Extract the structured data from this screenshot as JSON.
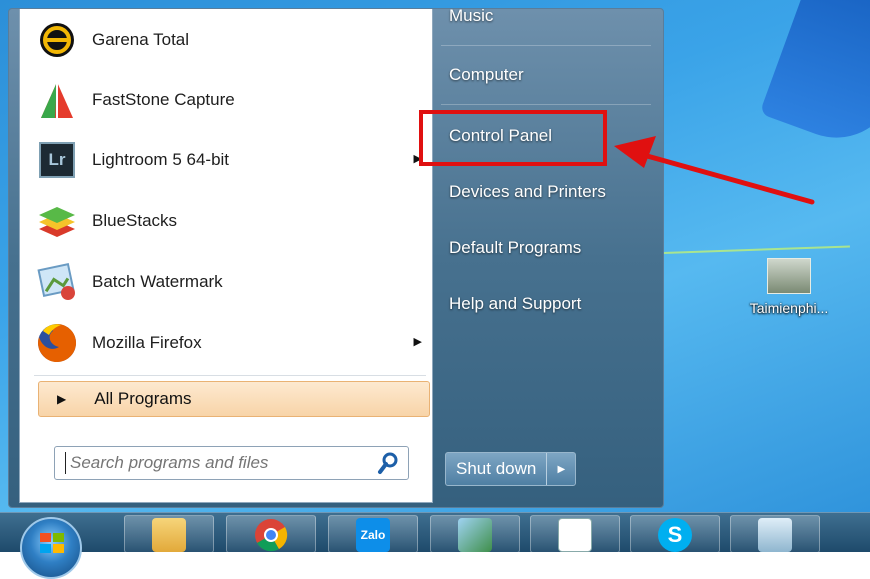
{
  "programs": [
    {
      "label": "Garena Total",
      "icon": "garena-icon",
      "has_submenu": false
    },
    {
      "label": "FastStone Capture",
      "icon": "faststone-capture-icon",
      "has_submenu": false
    },
    {
      "label": "Lightroom 5 64-bit",
      "icon": "lightroom-icon",
      "has_submenu": true
    },
    {
      "label": "BlueStacks",
      "icon": "bluestacks-icon",
      "has_submenu": false
    },
    {
      "label": "Batch Watermark",
      "icon": "batch-watermark-icon",
      "has_submenu": false
    },
    {
      "label": "Mozilla Firefox",
      "icon": "firefox-icon",
      "has_submenu": true
    }
  ],
  "all_programs": "All Programs",
  "search": {
    "placeholder": "Search programs and files"
  },
  "right_links": [
    "Music",
    "Computer",
    "Control Panel",
    "Devices and Printers",
    "Default Programs",
    "Help and Support"
  ],
  "highlighted_link": "Control Panel",
  "shutdown": {
    "label": "Shut down"
  },
  "lightroom_badge": "Lr",
  "desktop_icon": {
    "label": "Taimienphi..."
  },
  "taskbar": {
    "apps": [
      "file-explorer-icon",
      "chrome-icon",
      "zalo-icon",
      "photos-icon",
      "wordpad-icon",
      "skype-icon",
      "image-viewer-icon"
    ],
    "zalo_text": "Zalo",
    "skype_text": "S"
  },
  "colors": {
    "highlight": "#e01010",
    "all_programs_bg": "#fde9d0"
  }
}
